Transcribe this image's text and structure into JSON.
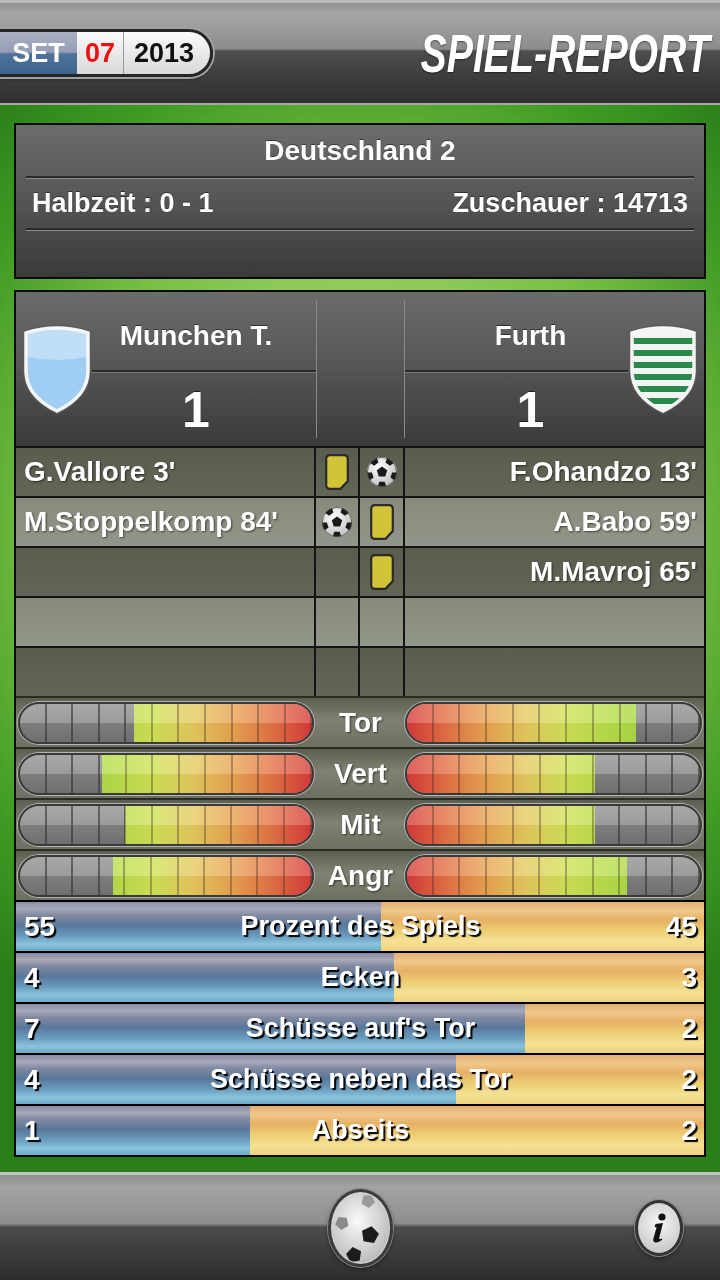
{
  "header": {
    "date": {
      "month": "SET",
      "day": "07",
      "year": "2013"
    },
    "title": "SPIEL-REPORT"
  },
  "match_info": {
    "league": "Deutschland 2",
    "halftime": "Halbzeit : 0 - 1",
    "attendance": "Zuschauer : 14713"
  },
  "teams": [
    {
      "name": "Munchen T.",
      "score": "1",
      "crest": {
        "kind": "plain",
        "color": "#9fcdf4"
      }
    },
    {
      "name": "Furth",
      "score": "1",
      "crest": {
        "kind": "striped",
        "color": "#2a8a4c"
      }
    }
  ],
  "events": [
    {
      "home": {
        "text": "G.Vallore 3'",
        "kind": "card"
      },
      "away": {
        "text": "F.Ohandzo 13'",
        "kind": "goal"
      }
    },
    {
      "home": {
        "text": "M.Stoppelkomp 84'",
        "kind": "goal"
      },
      "away": {
        "text": "A.Babo 59'",
        "kind": "card"
      }
    },
    {
      "away": {
        "text": "M.Mavroj 65'",
        "kind": "card"
      }
    }
  ],
  "ratings": [
    {
      "label": "Tor",
      "home": {
        "level": 0.61
      },
      "away": {
        "level": 0.78
      }
    },
    {
      "label": "Vert",
      "home": {
        "level": 0.72
      },
      "away": {
        "level": 0.64
      }
    },
    {
      "label": "Mit",
      "home": {
        "level": 0.64
      },
      "away": {
        "level": 0.64
      }
    },
    {
      "label": "Angr",
      "home": {
        "level": 0.68
      },
      "away": {
        "level": 0.75
      }
    }
  ],
  "stats": [
    {
      "home": "55",
      "label": "Prozent des Spiels",
      "away": "45",
      "level": 0.53
    },
    {
      "home": "4",
      "label": "Ecken",
      "away": "3",
      "level": 0.55
    },
    {
      "home": "7",
      "label": "Schüsse auf's Tor",
      "away": "2",
      "level": 0.74
    },
    {
      "home": "4",
      "label": "Schüsse neben das Tor",
      "away": "2",
      "level": 0.64
    },
    {
      "home": "1",
      "label": "Abseits",
      "away": "2",
      "level": 0.34
    }
  ]
}
